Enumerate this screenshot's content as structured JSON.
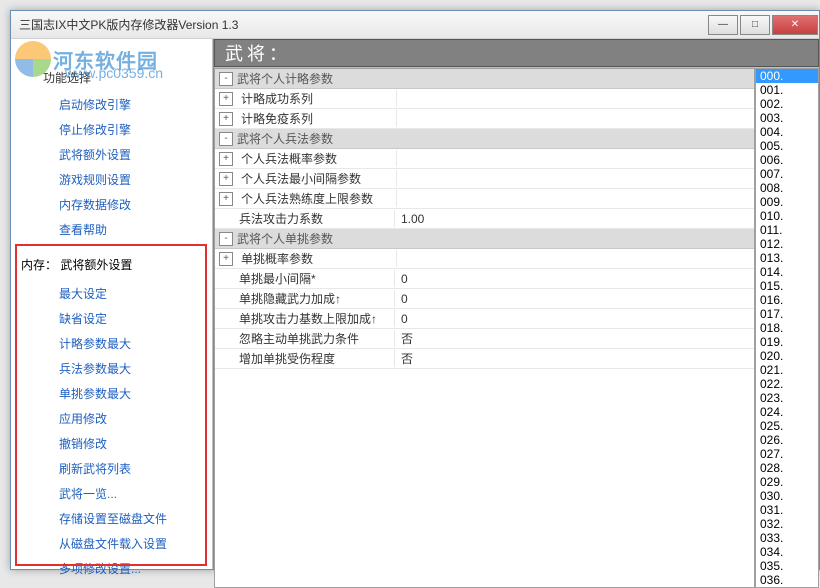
{
  "title": "三国志IX中文PK版内存修改器Version 1.3",
  "watermark": {
    "text": "河东软件园",
    "url": "www.pc0359.cn"
  },
  "sidebar": {
    "header": "功能选择",
    "menu1": [
      "启动修改引擎",
      "停止修改引擎",
      "武将额外设置",
      "游戏规则设置",
      "内存数据修改",
      "查看帮助"
    ],
    "sub_header": "内存： 武将额外设置",
    "menu2": [
      "最大设定",
      "缺省设定",
      "计略参数最大",
      "兵法参数最大",
      "单挑参数最大",
      "应用修改",
      "撤销修改",
      "刷新武将列表",
      "武将一览...",
      "存储设置至磁盘文件",
      "从磁盘文件载入设置",
      "多项修改设置..."
    ]
  },
  "main_header": "武将：",
  "propgrid": [
    {
      "type": "group",
      "label": "武将个人计略参数"
    },
    {
      "type": "child",
      "label": "计略成功系列"
    },
    {
      "type": "child",
      "label": "计略免疫系列"
    },
    {
      "type": "group",
      "label": "武将个人兵法参数"
    },
    {
      "type": "child",
      "label": "个人兵法概率参数"
    },
    {
      "type": "child",
      "label": "个人兵法最小间隔参数"
    },
    {
      "type": "child",
      "label": "个人兵法熟练度上限参数"
    },
    {
      "type": "row",
      "label": "兵法攻击力系数",
      "value": "1.00"
    },
    {
      "type": "group",
      "label": "武将个人单挑参数"
    },
    {
      "type": "child",
      "label": "单挑概率参数"
    },
    {
      "type": "row",
      "label": "单挑最小间隔*",
      "value": "0"
    },
    {
      "type": "row",
      "label": "单挑隐藏武力加成↑",
      "value": "0"
    },
    {
      "type": "row",
      "label": "单挑攻击力基数上限加成↑",
      "value": "0"
    },
    {
      "type": "row",
      "label": "忽略主动单挑武力条件",
      "value": "否"
    },
    {
      "type": "row",
      "label": "增加单挑受伤程度",
      "value": "否"
    }
  ],
  "list": {
    "count": 37,
    "selected": 0
  }
}
